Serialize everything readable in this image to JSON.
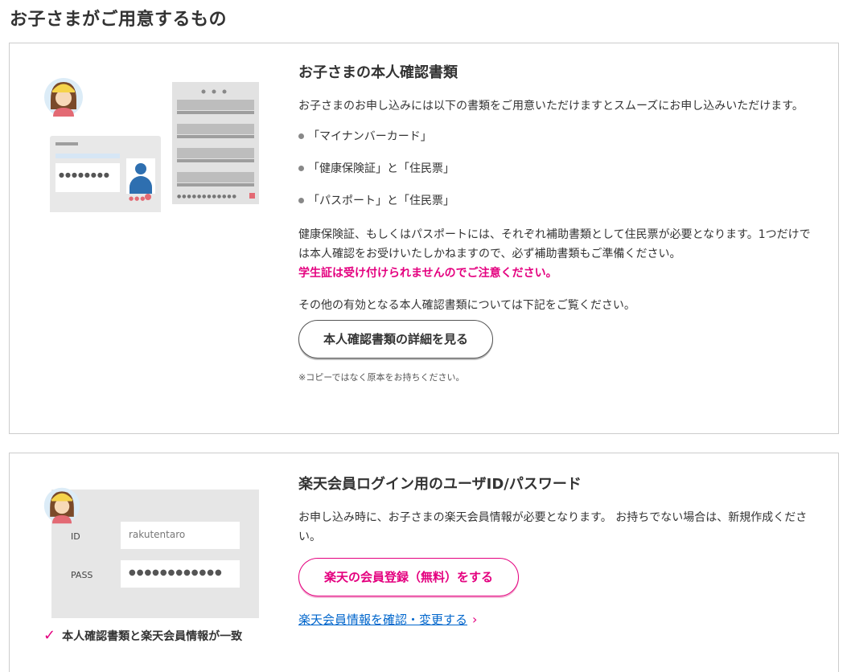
{
  "page": {
    "title": "お子さまがご用意するもの"
  },
  "card1": {
    "title": "お子さまの本人確認書類",
    "intro": "お子さまのお申し込みには以下の書類をご用意いただけますとスムーズにお申し込みいただけます。",
    "bullets": [
      "「マイナンバーカード」",
      "「健康保険証」と「住民票」",
      "「パスポート」と「住民票」"
    ],
    "body": "健康保険証、もしくはパスポートには、それぞれ補助書類として住民票が必要となります。1つだけでは本人確認をお受けいたしかねますので、必ず補助書類もご準備ください。",
    "warning": "学生証は受け付けられませんのでご注意ください。",
    "other": "その他の有効となる本人確認書類については下記をご覧ください。",
    "button": "本人確認書類の詳細を見る",
    "note": "※コピーではなく原本をお持ちください。",
    "illustration": {
      "id_dots": "●●●●●●●●",
      "doc_dots": "●●●●●●●●●●●●"
    }
  },
  "card2": {
    "title": "楽天会員ログイン用のユーザID/パスワード",
    "body": "お申し込み時に、お子さまの楽天会員情報が必要となります。 お持ちでない場合は、新規作成ください。",
    "button": "楽天の会員登録（無料）をする",
    "link": "楽天会員情報を確認・変更する",
    "illustration": {
      "id_label": "ID",
      "id_value": "rakutentaro",
      "pass_label": "PASS",
      "pass_value": "●●●●●●●●●●●●"
    },
    "check_text": "本人確認書類と楽天会員情報が一致"
  },
  "colors": {
    "accent": "#e4007f",
    "link": "#0066cc",
    "border": "#cccccc"
  }
}
